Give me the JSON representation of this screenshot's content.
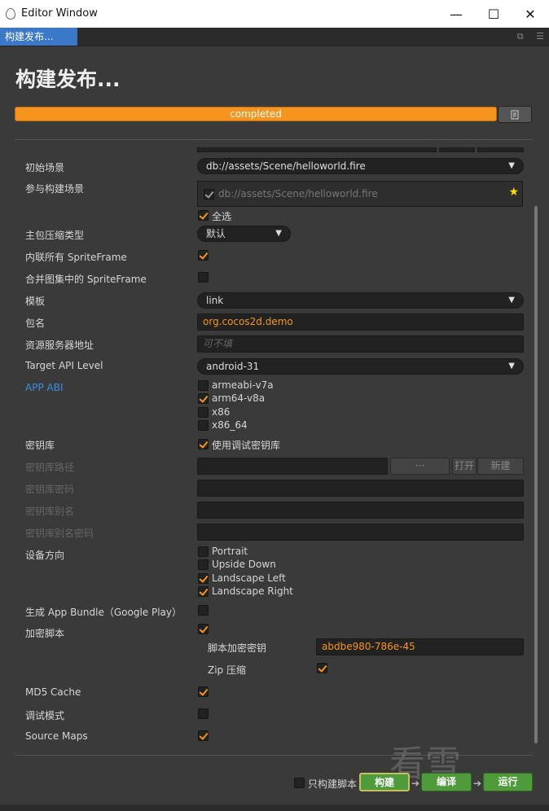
{
  "window": {
    "title": "Editor Window",
    "minimize": "—",
    "maximize": "☐",
    "close": "✕"
  },
  "tab": {
    "label": "构建发布..."
  },
  "page": {
    "title": "构建发布..."
  },
  "progress": {
    "label": "completed",
    "value": 1.0
  },
  "fields": {
    "initial_scene": {
      "label": "初始场景",
      "value": "db://assets/Scene/helloworld.fire"
    },
    "build_scenes": {
      "label": "参与构建场景",
      "scene": "db://assets/Scene/helloworld.fire",
      "select_all": "全选"
    },
    "compress_type": {
      "label": "主包压缩类型",
      "value": "默认"
    },
    "inline_spriteframe": {
      "label": "内联所有 SpriteFrame"
    },
    "merge_spriteframe": {
      "label": "合并图集中的 SpriteFrame"
    },
    "template": {
      "label": "模板",
      "value": "link"
    },
    "package_name": {
      "label": "包名",
      "value": "org.cocos2d.demo"
    },
    "server_address": {
      "label": "资源服务器地址",
      "placeholder": "可不填"
    },
    "target_api": {
      "label": "Target API Level",
      "value": "android-31"
    },
    "app_abi": {
      "label": "APP ABI",
      "options": [
        "armeabi-v7a",
        "arm64-v8a",
        "x86",
        "x86_64"
      ]
    },
    "keystore": {
      "label": "密钥库",
      "use_debug": "使用调试密钥库"
    },
    "keystore_path": {
      "label": "密钥库路径",
      "dots": "···",
      "open": "打开",
      "new": "新建"
    },
    "keystore_password": {
      "label": "密钥库密码"
    },
    "keystore_alias": {
      "label": "密钥库别名"
    },
    "keystore_alias_password": {
      "label": "密钥库别名密码"
    },
    "orientation": {
      "label": "设备方向",
      "options": [
        "Portrait",
        "Upside Down",
        "Landscape Left",
        "Landscape Right"
      ]
    },
    "app_bundle": {
      "label": "生成 App Bundle（Google Play）"
    },
    "encrypt_js": {
      "label": "加密脚本",
      "key_label": "脚本加密密钥",
      "key_value": "abdbe980-786e-45",
      "zip_label": "Zip 压缩"
    },
    "md5_cache": {
      "label": "MD5 Cache"
    },
    "debug_mode": {
      "label": "调试模式"
    },
    "source_maps": {
      "label": "Source Maps"
    }
  },
  "footer": {
    "only_script": "只构建脚本",
    "build": "构建",
    "compile": "编译",
    "run": "运行"
  },
  "watermark": "看雪",
  "colors": {
    "accent": "#f7941d",
    "tab": "#3c78c8",
    "button_green": "#4f9a3a",
    "link_blue": "#3b8fe0"
  }
}
